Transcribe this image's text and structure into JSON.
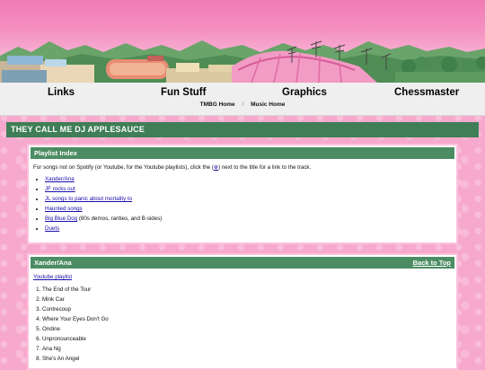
{
  "nav": {
    "links": [
      "Links",
      "Fun Stuff",
      "Graphics",
      "Chessmaster"
    ],
    "sub": [
      "TMBG Home",
      "Music Home"
    ],
    "separator": "/"
  },
  "page": {
    "title": "THEY CALL ME DJ APPLESAUCE"
  },
  "index": {
    "title": "Playlist Index",
    "intro_before": "For songs not on Spotify (or Youtube, for the Youtube playlists), click the (",
    "intro_symbol": "⊕",
    "intro_after": ") next to the title for a link to the track.",
    "items": [
      {
        "label": "Xander/Ana",
        "note": ""
      },
      {
        "label": "JF rocks out",
        "note": ""
      },
      {
        "label": "JL songs to panic about mortality to",
        "note": ""
      },
      {
        "label": "Haunted songs",
        "note": ""
      },
      {
        "label": "Big Blue Dog",
        "note": " (80s demos, rarities, and B-sides)"
      },
      {
        "label": "Duets",
        "note": ""
      }
    ]
  },
  "xander": {
    "title": "Xander/Ana",
    "back_to_top": "Back to Top",
    "playlist_link": "Youtube playlist",
    "tracks": [
      "The End of the Tour",
      "Mink Car",
      "Contrecoup",
      "Where Your Eyes Don't Go",
      "Ondine",
      "Unpronounceable",
      "Ana Ng",
      "She's An Angel"
    ]
  },
  "colors": {
    "header_green": "#3f7e57",
    "panel_green": "#4c8c63",
    "page_pink": "#f7a9cd",
    "nav_gray": "#efefef",
    "link_blue": "#1a0dab"
  }
}
